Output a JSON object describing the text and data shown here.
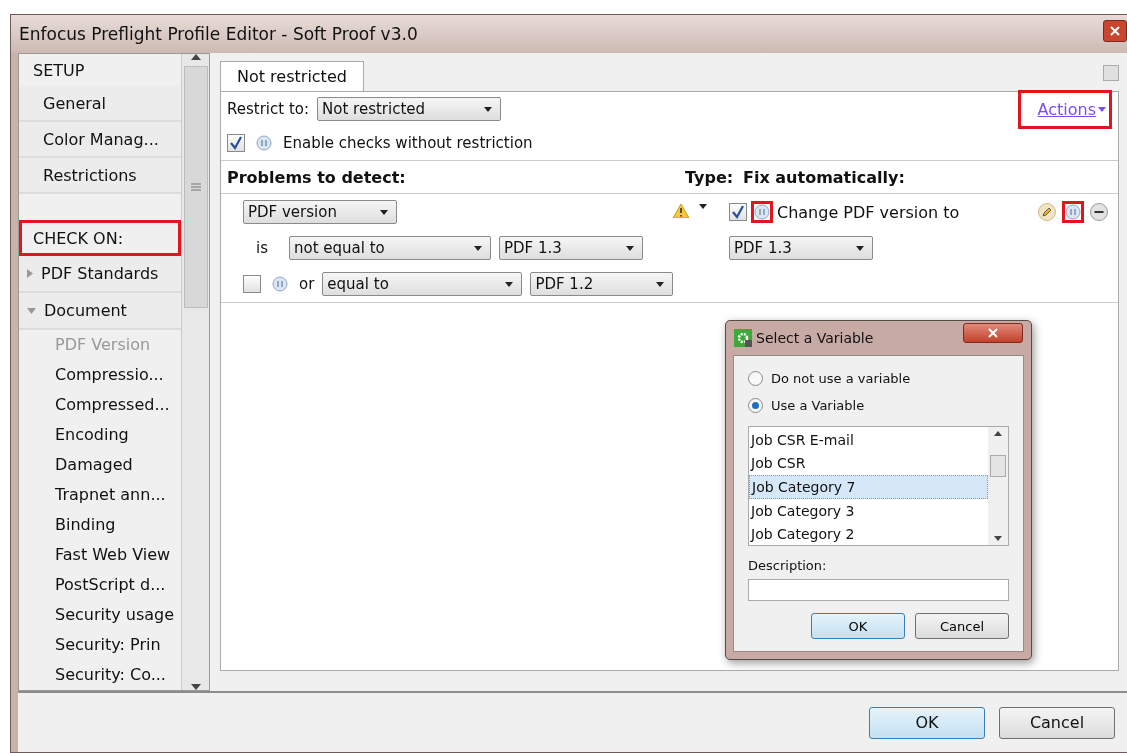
{
  "window": {
    "title": "Enfocus Preflight Profile Editor - Soft Proof v3.0"
  },
  "sidebar": {
    "setup": {
      "heading": "SETUP",
      "items": [
        {
          "label": "General"
        },
        {
          "label": "Color Manag..."
        },
        {
          "label": "Restrictions"
        }
      ]
    },
    "check_on": {
      "heading": "CHECK ON:",
      "highlighted": true,
      "groups": [
        {
          "label": "PDF Standards",
          "expanded": false
        },
        {
          "label": "Document",
          "expanded": true,
          "children": [
            {
              "label": "PDF Version",
              "disabled": true
            },
            {
              "label": "Compressio...",
              "disabled": false
            },
            {
              "label": "Compressed...",
              "disabled": false
            },
            {
              "label": "Encoding",
              "disabled": false
            },
            {
              "label": "Damaged",
              "disabled": false
            },
            {
              "label": "Trapnet ann...",
              "disabled": false
            },
            {
              "label": "Binding",
              "disabled": false
            },
            {
              "label": "Fast Web View",
              "disabled": false
            },
            {
              "label": "PostScript d...",
              "disabled": false
            },
            {
              "label": "Security usage",
              "disabled": false
            },
            {
              "label": "Security: Prin",
              "disabled": false
            },
            {
              "label": "Security: Co...",
              "disabled": false
            }
          ]
        }
      ]
    }
  },
  "tabs": [
    {
      "label": "Not restricted",
      "selected": true
    }
  ],
  "restrict": {
    "label": "Restrict to:",
    "value": "Not restricted"
  },
  "actions": {
    "label": "Actions",
    "highlighted": true
  },
  "enable": {
    "label": "Enable checks without restriction",
    "checked": true
  },
  "headers": {
    "problems": "Problems to detect:",
    "type": "Type:",
    "fix": "Fix automatically:"
  },
  "rule": {
    "property": "PDF version",
    "conditions": [
      {
        "kind": "first",
        "prefix": "is",
        "operator": "not equal to",
        "value": "PDF 1.3"
      },
      {
        "kind": "optional",
        "checked": false,
        "prefix": "or",
        "operator": "equal to",
        "value": "PDF 1.2"
      }
    ],
    "fix": {
      "checked": true,
      "label": "Change PDF version to",
      "value": "PDF 1.3",
      "variable_highlighted": true
    },
    "variable_highlighted": true
  },
  "dialog": {
    "title": "Select a Variable",
    "options": [
      {
        "label": "Do not use a variable",
        "selected": false
      },
      {
        "label": "Use a Variable",
        "selected": true
      }
    ],
    "list": [
      {
        "label": "Job CSR E-mail",
        "selected": false
      },
      {
        "label": "Job CSR",
        "selected": false
      },
      {
        "label": "Job Category 7",
        "selected": true
      },
      {
        "label": "Job Category 3",
        "selected": false
      },
      {
        "label": "Job Category 2",
        "selected": false
      }
    ],
    "description_label": "Description:",
    "buttons": [
      {
        "label": "OK",
        "default": true
      },
      {
        "label": "Cancel",
        "default": false
      }
    ]
  },
  "buttons": [
    {
      "label": "OK",
      "default": true
    },
    {
      "label": "Cancel",
      "default": false
    }
  ]
}
